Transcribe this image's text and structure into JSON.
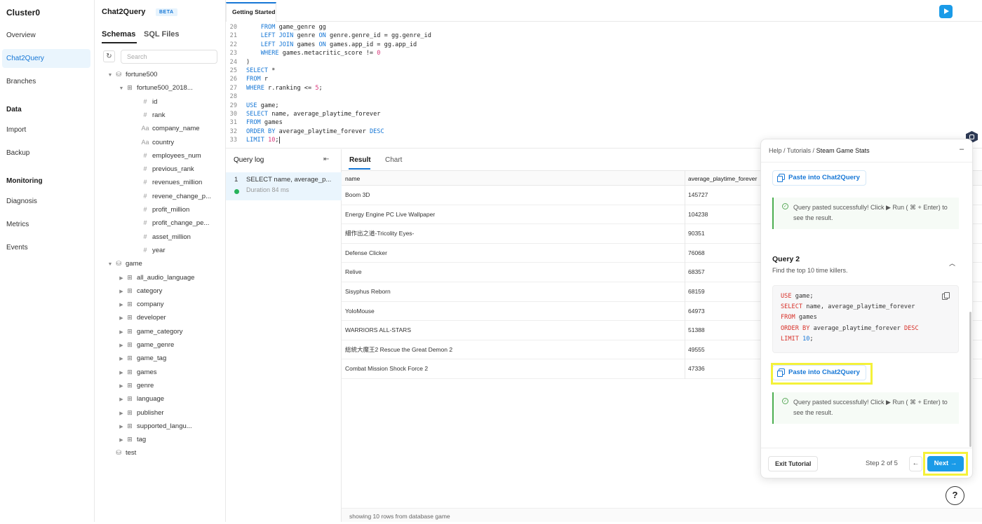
{
  "nav": {
    "cluster": "Cluster0",
    "overview": "Overview",
    "chat2query": "Chat2Query",
    "branches": "Branches",
    "data_section": "Data",
    "import": "Import",
    "backup": "Backup",
    "monitoring_section": "Monitoring",
    "diagnosis": "Diagnosis",
    "metrics": "Metrics",
    "events": "Events"
  },
  "schema_panel": {
    "title": "Chat2Query",
    "beta": "BETA",
    "tab_schemas": "Schemas",
    "tab_sql_files": "SQL Files",
    "search_placeholder": "Search",
    "tree": [
      {
        "label": "fortune500",
        "level": 0,
        "kind": "db",
        "expanded": true
      },
      {
        "label": "fortune500_2018...",
        "level": 1,
        "kind": "table",
        "expanded": true
      },
      {
        "label": "id",
        "level": 2,
        "kind": "num"
      },
      {
        "label": "rank",
        "level": 2,
        "kind": "num"
      },
      {
        "label": "company_name",
        "level": 2,
        "kind": "text"
      },
      {
        "label": "country",
        "level": 2,
        "kind": "text"
      },
      {
        "label": "employees_num",
        "level": 2,
        "kind": "num"
      },
      {
        "label": "previous_rank",
        "level": 2,
        "kind": "num"
      },
      {
        "label": "revenues_million",
        "level": 2,
        "kind": "num"
      },
      {
        "label": "revene_change_p...",
        "level": 2,
        "kind": "num"
      },
      {
        "label": "profit_million",
        "level": 2,
        "kind": "num"
      },
      {
        "label": "profit_change_pe...",
        "level": 2,
        "kind": "num"
      },
      {
        "label": "asset_million",
        "level": 2,
        "kind": "num"
      },
      {
        "label": "year",
        "level": 2,
        "kind": "num"
      },
      {
        "label": "game",
        "level": 0,
        "kind": "db",
        "expanded": true
      },
      {
        "label": "all_audio_language",
        "level": 1,
        "kind": "table"
      },
      {
        "label": "category",
        "level": 1,
        "kind": "table"
      },
      {
        "label": "company",
        "level": 1,
        "kind": "table"
      },
      {
        "label": "developer",
        "level": 1,
        "kind": "table"
      },
      {
        "label": "game_category",
        "level": 1,
        "kind": "table"
      },
      {
        "label": "game_genre",
        "level": 1,
        "kind": "table"
      },
      {
        "label": "game_tag",
        "level": 1,
        "kind": "table"
      },
      {
        "label": "games",
        "level": 1,
        "kind": "table"
      },
      {
        "label": "genre",
        "level": 1,
        "kind": "table"
      },
      {
        "label": "language",
        "level": 1,
        "kind": "table"
      },
      {
        "label": "publisher",
        "level": 1,
        "kind": "table"
      },
      {
        "label": "supported_langu...",
        "level": 1,
        "kind": "table"
      },
      {
        "label": "tag",
        "level": 1,
        "kind": "table"
      },
      {
        "label": "test",
        "level": 0,
        "kind": "db-flat"
      }
    ]
  },
  "editor": {
    "tab": "Getting Started",
    "lines": [
      {
        "n": "20",
        "html": "    <span class='kw'>FROM</span> game_genre gg"
      },
      {
        "n": "21",
        "html": "    <span class='kw'>LEFT JOIN</span> genre <span class='kw'>ON</span> genre.genre_id = gg.genre_id"
      },
      {
        "n": "22",
        "html": "    <span class='kw'>LEFT JOIN</span> games <span class='kw'>ON</span> games.app_id = gg.app_id"
      },
      {
        "n": "23",
        "html": "    <span class='kw'>WHERE</span> games.metacritic_score != <span class='num'>0</span>"
      },
      {
        "n": "24",
        "html": ")"
      },
      {
        "n": "25",
        "html": "<span class='kw'>SELECT</span> *"
      },
      {
        "n": "26",
        "html": "<span class='kw'>FROM</span> r"
      },
      {
        "n": "27",
        "html": "<span class='kw'>WHERE</span> r.ranking &lt;= <span class='num'>5</span>;"
      },
      {
        "n": "28",
        "html": ""
      },
      {
        "n": "29",
        "html": "<span class='kw'>USE</span> game;"
      },
      {
        "n": "30",
        "html": "<span class='kw'>SELECT</span> name, average_playtime_forever"
      },
      {
        "n": "31",
        "html": "<span class='kw'>FROM</span> games"
      },
      {
        "n": "32",
        "html": "<span class='kw'>ORDER BY</span> average_playtime_forever <span class='kw'>DESC</span>"
      },
      {
        "n": "33",
        "html": "<span class='kw'>LIMIT</span> <span class='num'>10</span>;<span class='cursor'></span>"
      }
    ]
  },
  "query_log": {
    "header": "Query log",
    "items": [
      {
        "idx": "1",
        "query": "SELECT name, average_p...",
        "duration": "Duration 84 ms"
      }
    ]
  },
  "results": {
    "tab_result": "Result",
    "tab_chart": "Chart",
    "columns": [
      "name",
      "average_playtime_forever"
    ],
    "rows": [
      [
        "Boom 3D",
        "145727"
      ],
      [
        "Energy Engine PC Live Wallpaper",
        "104238"
      ],
      [
        "細作出之道-Tricolity Eyes-",
        "90351"
      ],
      [
        "Defense Clicker",
        "76068"
      ],
      [
        "Relive",
        "68357"
      ],
      [
        "Sisyphus Reborn",
        "68159"
      ],
      [
        "YoloMouse",
        "64973"
      ],
      [
        "WARRIORS ALL-STARS",
        "51388"
      ],
      [
        "総統大魔王2 Rescue the Great Demon 2",
        "49555"
      ],
      [
        "Combat Mission Shock Force 2",
        "47336"
      ]
    ],
    "footer": "showing 10 rows from database game"
  },
  "tutorial": {
    "crumb_help": "Help",
    "crumb_sep": " / ",
    "crumb_tutorials": "Tutorials",
    "crumb_current": "Steam Game Stats",
    "paste_label": "Paste into Chat2Query",
    "success_text": "Query pasted successfully! Click ▶ Run ( ⌘ + Enter) to see the result.",
    "query_title": "Query 2",
    "query_desc": "Find the top 10 time killers.",
    "code": [
      "<span class='k'>USE</span> game;",
      "<span class='k'>SELECT</span> name, average_playtime_forever",
      "<span class='k'>FROM</span> games",
      "<span class='k'>ORDER BY</span> average_playtime_forever <span class='k'>DESC</span>",
      "<span class='k'>LIMIT</span> <span class='n'>10</span>;"
    ],
    "exit": "Exit Tutorial",
    "step": "Step 2 of 5",
    "next": "Next →",
    "highlight_color": "#f4f13a"
  },
  "help_button": "?"
}
